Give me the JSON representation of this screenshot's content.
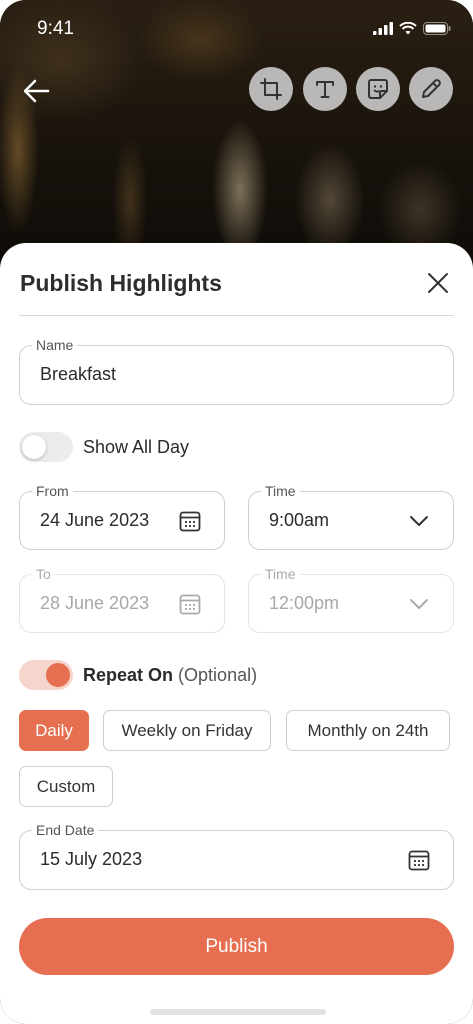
{
  "status": {
    "time": "9:41"
  },
  "sheet": {
    "title": "Publish Highlights",
    "name_field": {
      "label": "Name",
      "value": "Breakfast"
    },
    "show_all_day": {
      "label": "Show All Day",
      "on": false
    },
    "from": {
      "label": "From",
      "value": "24 June 2023"
    },
    "from_time": {
      "label": "Time",
      "value": "9:00am"
    },
    "to": {
      "label": "To",
      "value": "28 June 2023"
    },
    "to_time": {
      "label": "Time",
      "value": "12:00pm"
    },
    "repeat": {
      "label": "Repeat On",
      "optional": "(Optional)",
      "on": true
    },
    "chips": [
      {
        "label": "Daily",
        "active": true
      },
      {
        "label": "Weekly on Friday",
        "active": false
      },
      {
        "label": "Monthly on 24th",
        "active": false
      },
      {
        "label": "Custom",
        "active": false
      }
    ],
    "end_date": {
      "label": "End Date",
      "value": "15 July 2023"
    },
    "publish_label": "Publish"
  },
  "colors": {
    "accent": "#e76f51",
    "accent_light": "#f6d6cc",
    "border": "#cfcfcf"
  },
  "icons": [
    "back-arrow-icon",
    "crop-icon",
    "text-icon",
    "sticker-icon",
    "pencil-icon",
    "close-icon",
    "calendar-icon",
    "chevron-down-icon",
    "signal-icon",
    "wifi-icon",
    "battery-icon"
  ]
}
